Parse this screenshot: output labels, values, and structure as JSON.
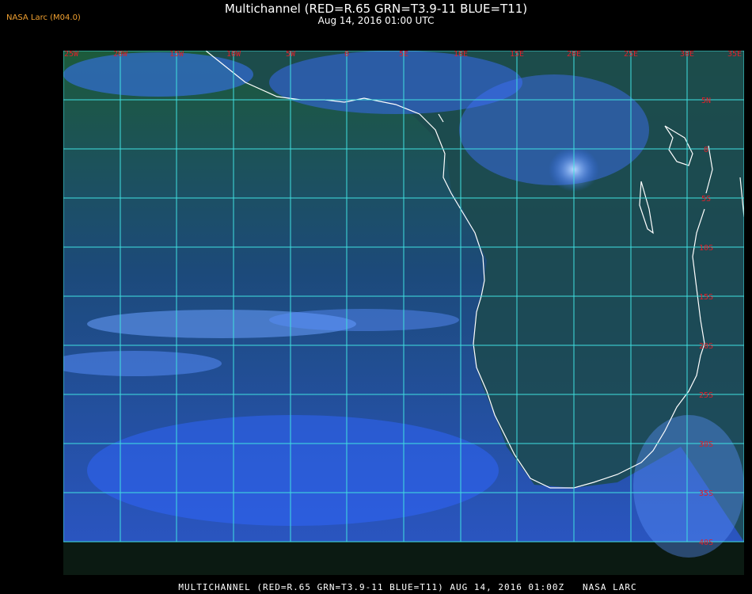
{
  "header": {
    "credit": "NASA Larc (M04.0)",
    "title": "Multichannel (RED=R.65 GRN=T3.9-11 BLUE=T11)",
    "subtitle": "Aug 14, 2016 01:00 UTC"
  },
  "footer": {
    "caption": "MULTICHANNEL (RED=R.65 GRN=T3.9-11 BLUE=T11) AUG 14, 2016 01:00Z   NASA LARC"
  },
  "map": {
    "longitude_labels": [
      "25W",
      "20W",
      "15W",
      "10W",
      "5W",
      "0",
      "5E",
      "10E",
      "15E",
      "20E",
      "25E",
      "30E",
      "35E"
    ],
    "latitude_labels": [
      "5N",
      "0",
      "5S",
      "10S",
      "15S",
      "20S",
      "25S",
      "30S",
      "35S",
      "40S"
    ],
    "colors": {
      "grid": "#40e0e0",
      "coast": "#ffffff",
      "labels": "#e0202a",
      "ocean": "#1a4a9a",
      "land": "#1e4a2a"
    }
  }
}
